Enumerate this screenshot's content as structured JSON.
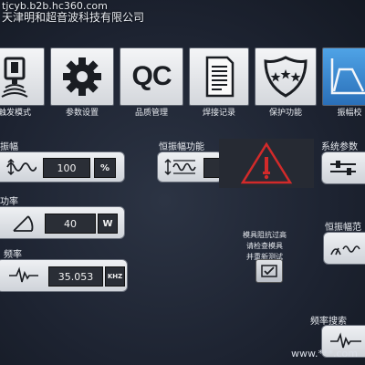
{
  "watermark": {
    "site": "tjcyb.b2b.hc360.com",
    "company": "天津明和超音波科技有限公司",
    "corner": "www.***.com"
  },
  "nav": {
    "tabs": [
      {
        "label": "触发模式",
        "icon": "trigger-icon"
      },
      {
        "label": "参数设置",
        "icon": "gear-icon"
      },
      {
        "label": "品质管理",
        "icon": "qc-icon",
        "text": "QC"
      },
      {
        "label": "焊接记录",
        "icon": "document-icon"
      },
      {
        "label": "保护功能",
        "icon": "shield-icon"
      },
      {
        "label": "振幅校",
        "icon": "amplitude-curve-icon",
        "active": true
      }
    ]
  },
  "amplitude": {
    "label": "振幅",
    "value": "100",
    "unit": "%"
  },
  "power": {
    "label": "功率",
    "value": "40",
    "unit": "W"
  },
  "frequency": {
    "label": "频率",
    "value": "35.053",
    "unit": "KHZ"
  },
  "constant_amplitude": {
    "label": "恒振幅功能"
  },
  "system_params": {
    "label": "系统参数"
  },
  "constant_amplitude_range": {
    "label": "恒振幅范"
  },
  "frequency_search": {
    "label": "频率搜索"
  },
  "alarm": {
    "lines": [
      "模具阻抗过高",
      "请检查模具",
      "并重新测试"
    ]
  },
  "colors": {
    "accent": "#3b8ad4",
    "alarm_red": "#d22a2a",
    "background": "#1c2230"
  }
}
